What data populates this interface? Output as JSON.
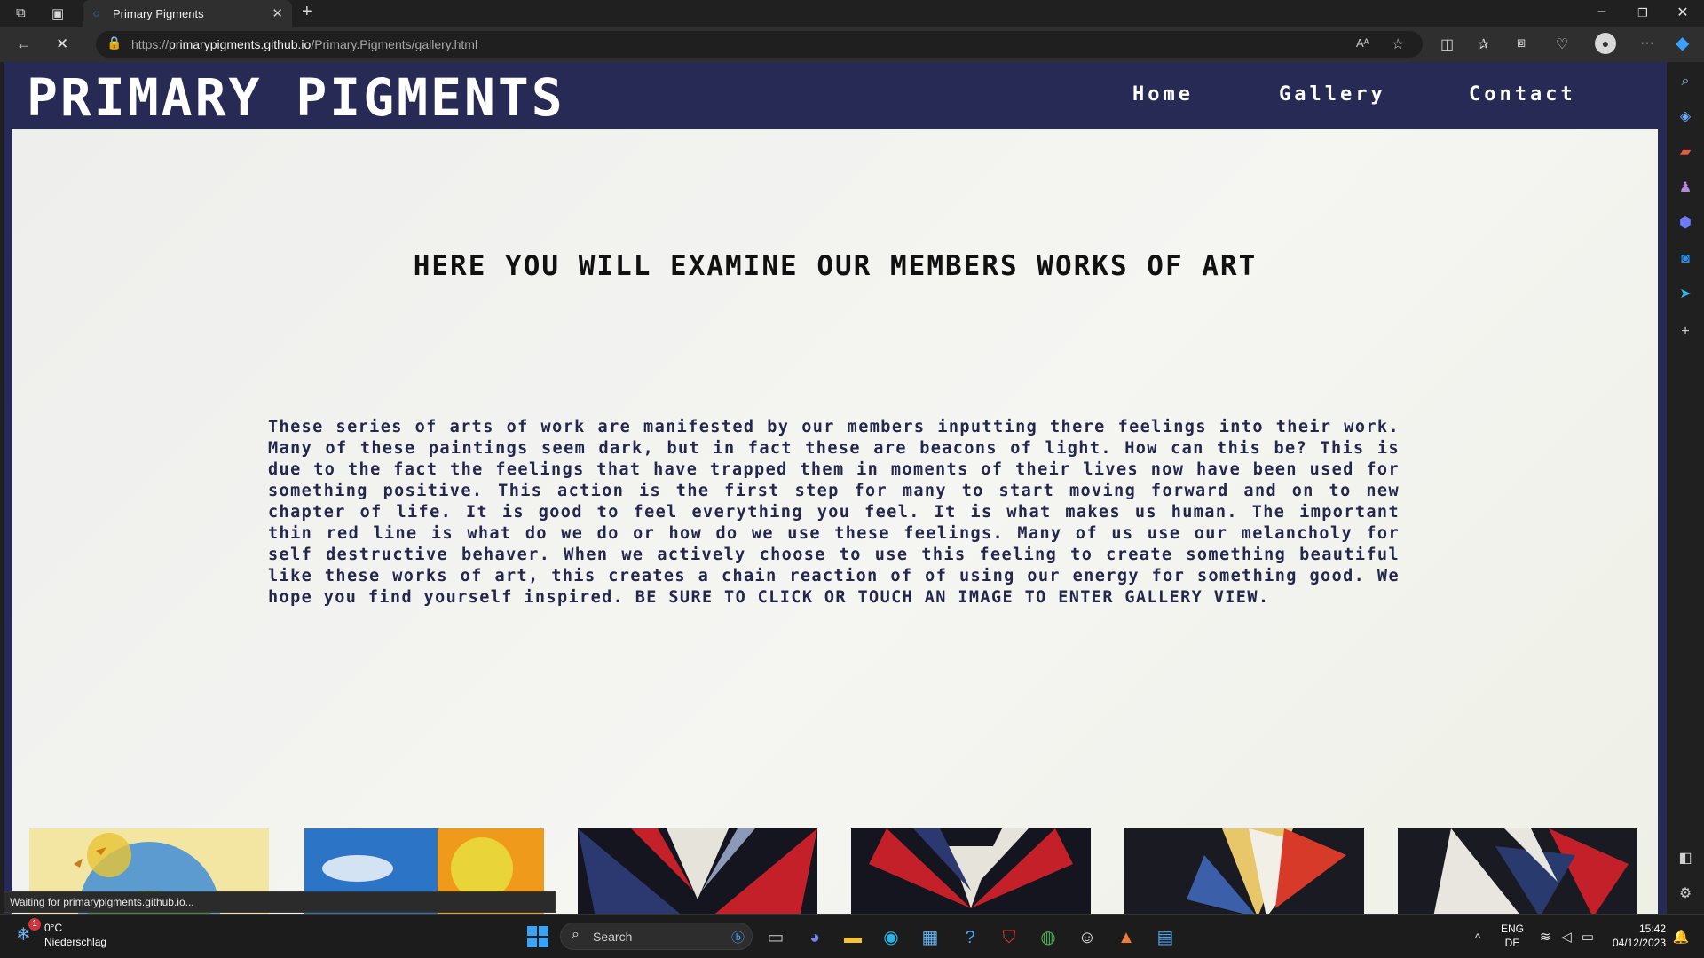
{
  "browser": {
    "tab_title": "Primary Pigments",
    "new_tab_label": "+",
    "url_prefix": "https://",
    "url_host": "primarypigments.github.io",
    "url_path": "/Primary.Pigments/gallery.html",
    "status_text": "Waiting for primarypigments.github.io..."
  },
  "site": {
    "brand": "PRIMARY PIGMENTS",
    "nav": [
      {
        "label": "Home"
      },
      {
        "label": "Gallery"
      },
      {
        "label": "Contact"
      }
    ],
    "headline": "HERE YOU WILL EXAMINE OUR MEMBERS WORKS OF ART",
    "paragraph": "These series of arts of work are manifested by our members inputting there feelings into their work. Many of these paintings seem dark, but in fact these are beacons of light. How can this be? This is due to the fact the feelings that have trapped them in moments of their lives now have been used for something positive. This action is the first step for many to start moving forward and on to new chapter of life. It is good to feel everything you feel. It is what makes us human. The important thin red line is what do we do or how do we use these feelings. Many of us use our melancholy for self destructive behaver. When we actively choose to use this feeling to create something beautiful like these works of art, this creates a chain reaction of of using our energy for something good. We hope you find yourself inspired. BE SURE TO CLICK OR TOUCH AN IMAGE TO ENTER GALLERY VIEW.",
    "gallery_thumbs": [
      {
        "name": "painting-1",
        "palette": [
          "#e9c437",
          "#5b9bd0",
          "#3f8a3c",
          "#f3e6a2"
        ]
      },
      {
        "name": "painting-2",
        "palette": [
          "#2c74c6",
          "#f09a1b",
          "#e9d43a",
          "#ffffff"
        ]
      },
      {
        "name": "painting-3",
        "palette": [
          "#c4202a",
          "#2b3970",
          "#e6e3da",
          "#151520"
        ]
      },
      {
        "name": "painting-4",
        "palette": [
          "#151520",
          "#c4202a",
          "#e6e3da",
          "#2b3970"
        ]
      },
      {
        "name": "painting-5",
        "palette": [
          "#1a1a22",
          "#e8c66a",
          "#d83a2a",
          "#f2efe6"
        ]
      },
      {
        "name": "painting-6",
        "palette": [
          "#1a1a22",
          "#c4202a",
          "#e9e6df",
          "#283a6e"
        ]
      }
    ]
  },
  "taskbar": {
    "temperature": "0°C",
    "weather_desc": "Niederschlag",
    "weather_badge": "1",
    "search_placeholder": "Search",
    "lang_top": "ENG",
    "lang_bottom": "DE",
    "time": "15:42",
    "date": "04/12/2023"
  },
  "colors": {
    "site_header": "#262a55",
    "content_bg": "#f2f2ef",
    "browser_chrome": "#202020"
  }
}
